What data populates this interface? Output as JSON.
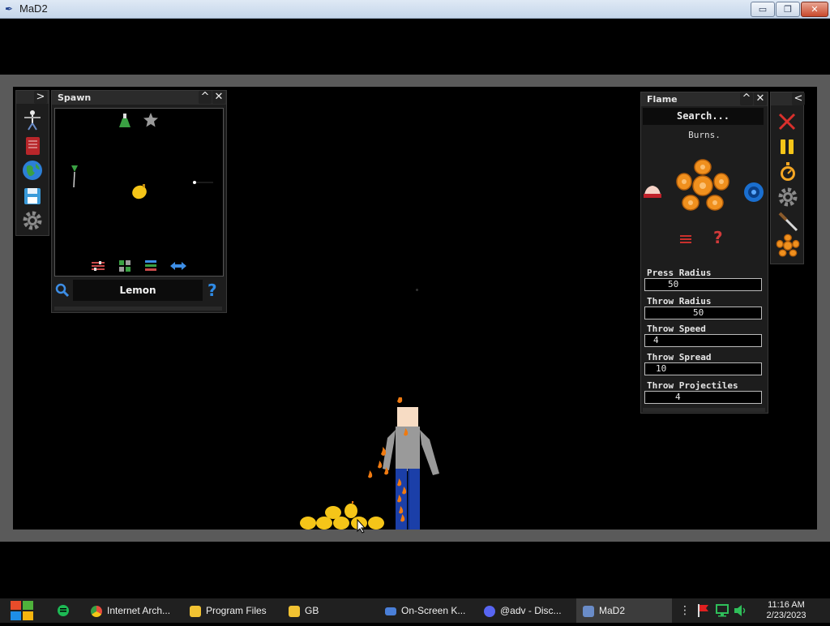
{
  "window": {
    "title": "MaD2",
    "minimize": "▭",
    "maximize": "❐",
    "close": "✕"
  },
  "spawn_panel": {
    "title": "Spawn",
    "collapse_symbol": "^",
    "close_symbol": "✕",
    "selected_item": "Lemon",
    "help_symbol": "?"
  },
  "left_toolbar": {
    "expand_symbol": ">"
  },
  "flame_panel": {
    "title": "Flame",
    "collapse_symbol": "^",
    "close_symbol": "✕",
    "search_placeholder": "Search...",
    "description": "Burns.",
    "help_symbol": "?",
    "params": [
      {
        "label": "Press Radius",
        "value": "50"
      },
      {
        "label": "Throw Radius",
        "value": "50"
      },
      {
        "label": "Throw Speed",
        "value": "4"
      },
      {
        "label": "Throw Spread",
        "value": "10"
      },
      {
        "label": "Throw Projectiles",
        "value": "4"
      }
    ]
  },
  "right_toolbar": {
    "collapse_symbol": "<"
  },
  "taskbar": {
    "items": [
      {
        "label": "Internet Arch...",
        "icon": "chrome-icon"
      },
      {
        "label": "Program Files",
        "icon": "folder-icon"
      },
      {
        "label": "GB",
        "icon": "folder-icon"
      },
      {
        "label": "On-Screen K...",
        "icon": "keyboard-icon"
      },
      {
        "label": "@adv - Disc...",
        "icon": "discord-icon"
      },
      {
        "label": "MaD2",
        "icon": "mad2-icon"
      }
    ],
    "time": "11:16 AM",
    "date": "2/23/2023"
  },
  "colors": {
    "accent_blue": "#3d8ee6",
    "flame_orange": "#f0901e",
    "lemon_yellow": "#f5c518",
    "help_blue": "#2f8be6"
  }
}
